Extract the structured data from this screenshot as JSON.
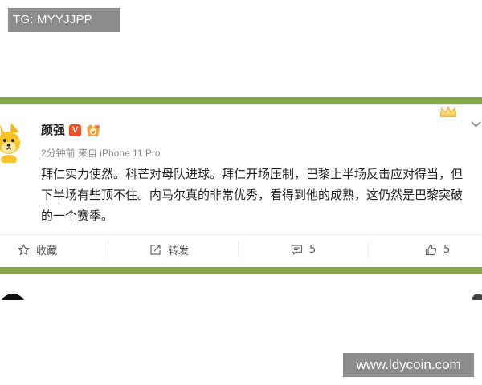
{
  "overlay": {
    "tg_label": "TG: MYYJJPP",
    "watermark": "www.ldycoin.com"
  },
  "post": {
    "username": "颜强",
    "verified_badge": "V",
    "meta": "2分钟前 来自 iPhone 11 Pro",
    "content_lines": [
      "拜仁实力使然。科芒对母队进球。拜仁开场压制，巴黎上半场反击应对得当，但",
      "下半场有些顶不住。内马尔真的非常优秀，看得到他的成熟，这仍然是巴黎突破",
      "的一个赛季。"
    ],
    "actions": {
      "favorite_label": "收藏",
      "share_label": "转发",
      "comment_count": "5",
      "like_count": "5"
    }
  },
  "icons": {
    "avatar": "cartoon-dog-avatar-icon",
    "vip": "vip-medal-icon",
    "crown": "crown-decoration-icon",
    "more": "chevron-down-icon",
    "favorite": "star-icon",
    "share": "share-icon",
    "comment": "comment-icon",
    "like": "thumbs-up-icon"
  },
  "colors": {
    "band_green": "#86a64a",
    "verified_orange": "#f04f26",
    "overlay_gray": "#8c8c8c"
  }
}
